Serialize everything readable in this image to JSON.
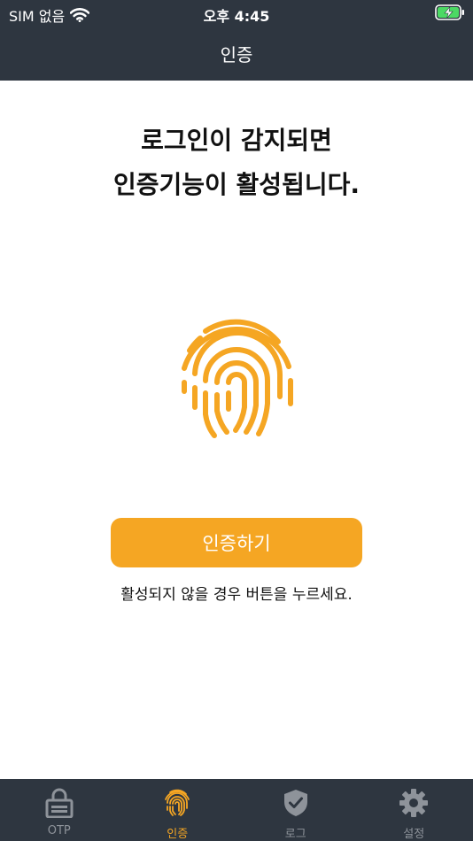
{
  "status_bar": {
    "carrier": "SIM 없음",
    "time": "오후 4:45"
  },
  "header": {
    "title": "인증"
  },
  "main": {
    "headline_line1": "로그인이 감지되면",
    "headline_line2": "인증기능이 활성됩니다.",
    "auth_button_label": "인증하기",
    "helper_text": "활성되지 않을 경우 버튼을 누르세요."
  },
  "tabs": [
    {
      "label": "OTP",
      "icon": "lock-icon",
      "active": false
    },
    {
      "label": "인증",
      "icon": "fingerprint-icon",
      "active": true
    },
    {
      "label": "로그",
      "icon": "shield-check-icon",
      "active": false
    },
    {
      "label": "설정",
      "icon": "gear-icon",
      "active": false
    }
  ],
  "colors": {
    "accent": "#f5a623",
    "bar_background": "#2e3640",
    "inactive_tab": "#8e939a",
    "battery_fill": "#4cd964"
  }
}
